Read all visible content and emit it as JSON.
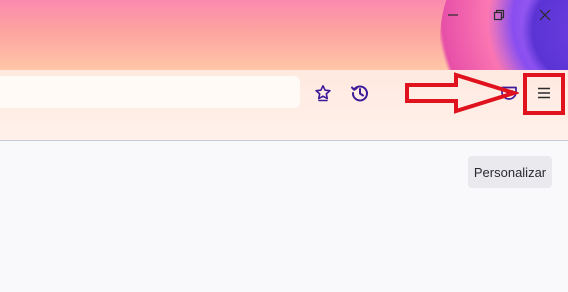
{
  "window": {
    "controls": [
      {
        "name": "minimize",
        "icon": "minimize-icon"
      },
      {
        "name": "restore",
        "icon": "restore-icon"
      },
      {
        "name": "close",
        "icon": "close-icon"
      }
    ]
  },
  "toolbar": {
    "url_value": "",
    "icons": [
      "bookmark-star-icon",
      "history-icon",
      "pocket-icon",
      "menu-icon"
    ]
  },
  "annotation": {
    "arrow_color": "#e0121e",
    "box_color": "#e0121e",
    "target": "menu-button"
  },
  "content": {
    "personalize_label": "Personalizar"
  },
  "colors": {
    "accent_icon": "#3b1b9a",
    "annotation_red": "#e0121e"
  }
}
